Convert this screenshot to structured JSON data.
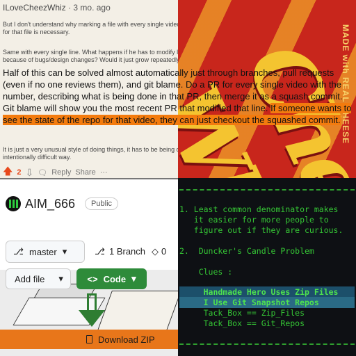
{
  "comment": {
    "username": "ILoveCheezWhiz",
    "time_ago": "· 3 mo. ago",
    "line1": "But I don't understand why marking a file with every single video that has a change for that file is necessary.",
    "line2": "Same with every single line. What happens if he has to modify lines repeatedly because of bugs/design changes? Would it just grow repeatedly?",
    "reply_part1": "Half of this can be solved almost automatically just through branches, pull requests (even if no one reviews them), and git blame. Do a PR for every single video with the number, describing what is being done in that PR, then merge it as a squash commit. Git blame will show you the most recent PR that modified that line.",
    "reply_part2": "If someone wants to see the state of the repo for that video, they can just checkout the squashed commit.",
    "line3": "It is just a very unusual style of doing things, it has to be being done in an intentionally difficult way.",
    "upvote_count": "2",
    "reply_label": "Reply",
    "share_label": "Share",
    "more_label": "···"
  },
  "cheez": {
    "logo_text": "Cheez Whiz",
    "side_text": "MADE with REAL CHEESE"
  },
  "github": {
    "repo_name": "AIM_666",
    "visibility": "Public",
    "branch_name": "master",
    "branch_count_label": "1 Branch",
    "tag_count_label": "0",
    "add_file_label": "Add file",
    "code_label": "Code",
    "download_zip_label": "Download ZIP"
  },
  "terminal": {
    "lines": [
      "1. Least common denominator makes",
      "   it easier for more people to",
      "   figure out if they are curious.",
      "",
      "2.  Duncker's Candle Problem",
      "",
      "    Clues :",
      "",
      "     Handmade Hero Uses Zip Files",
      "     I Use Git Snapshot Repos",
      "     Tack_Box == Zip_Files",
      "     Tack_Box == Git_Repos"
    ]
  },
  "colors": {
    "orange_highlight": "#f37b0e",
    "code_button": "#2e8b3a",
    "terminal_green": "#35c635",
    "terminal_highlight": "#1c4f6a"
  }
}
